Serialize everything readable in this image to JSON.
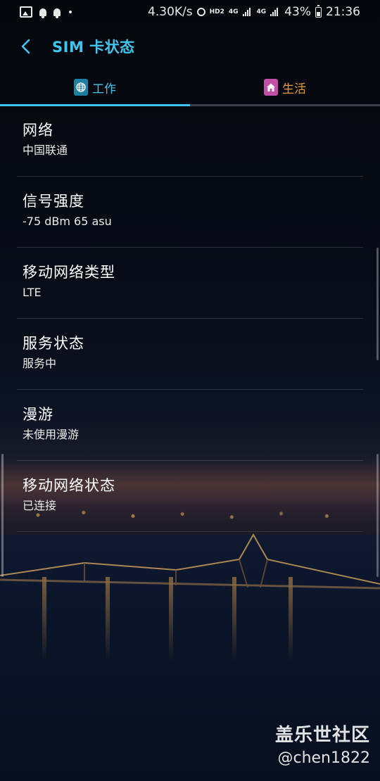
{
  "status_bar": {
    "speed": "4.30K/s",
    "hd_label": "HD2",
    "network_1": "4G",
    "network_2": "4G",
    "battery": "43%",
    "time": "21:36"
  },
  "header": {
    "title": "SIM 卡状态"
  },
  "tabs": [
    {
      "label": "工作",
      "icon": "globe-icon",
      "color": "#3ec6ef"
    },
    {
      "label": "生活",
      "icon": "home-icon",
      "color": "#e59a3a"
    }
  ],
  "items": [
    {
      "title": "网络",
      "value": "中国联通"
    },
    {
      "title": "信号强度",
      "value": "-75 dBm 65 asu"
    },
    {
      "title": "移动网络类型",
      "value": "LTE"
    },
    {
      "title": "服务状态",
      "value": "服务中"
    },
    {
      "title": "漫游",
      "value": "未使用漫游"
    },
    {
      "title": "移动网络状态",
      "value": "已连接"
    }
  ],
  "watermark": {
    "title": "盖乐世社区",
    "user": "@chen1822"
  }
}
